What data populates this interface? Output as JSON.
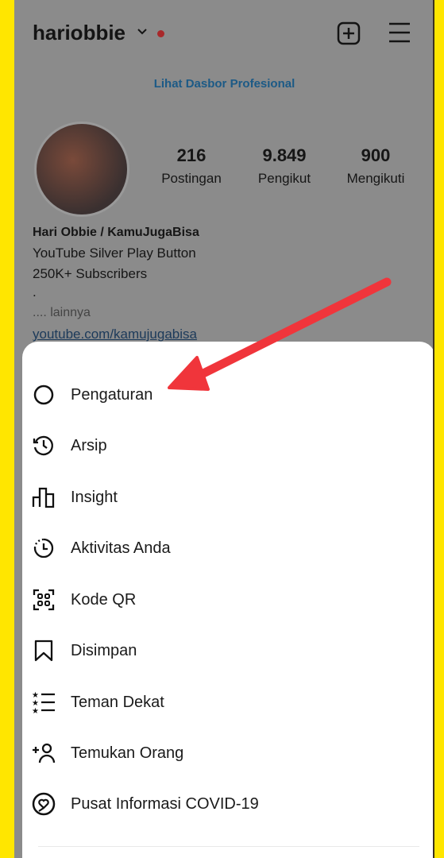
{
  "header": {
    "username": "hariobbie",
    "icons": [
      "chevron-down-icon",
      "notification-dot",
      "add-post-icon",
      "hamburger-menu-icon"
    ]
  },
  "professional_dashboard": "Lihat Dasbor Profesional",
  "stats": [
    {
      "value": "216",
      "label": "Postingan"
    },
    {
      "value": "9.849",
      "label": "Pengikut"
    },
    {
      "value": "900",
      "label": "Mengikuti"
    }
  ],
  "bio": {
    "name": "Hari Obbie / KamuJugaBisa",
    "line1": "YouTube Silver Play Button",
    "line2": "250K+ Subscribers",
    "line3": ".",
    "more": ".... lainnya",
    "link": "youtube.com/kamujugabisa"
  },
  "menu": [
    {
      "label": "Pengaturan",
      "icon": "settings-icon"
    },
    {
      "label": "Arsip",
      "icon": "archive-icon"
    },
    {
      "label": "Insight",
      "icon": "insights-icon"
    },
    {
      "label": "Aktivitas Anda",
      "icon": "activity-icon"
    },
    {
      "label": "Kode QR",
      "icon": "qr-code-icon"
    },
    {
      "label": "Disimpan",
      "icon": "bookmark-icon"
    },
    {
      "label": "Teman Dekat",
      "icon": "close-friends-icon"
    },
    {
      "label": "Temukan Orang",
      "icon": "add-person-icon"
    },
    {
      "label": "Pusat Informasi COVID-19",
      "icon": "covid-info-icon"
    }
  ],
  "colors": {
    "frame": "#ffe600",
    "overlay": "#8b8b8b",
    "arrow": "#f0353b",
    "link": "#1c5a86"
  }
}
